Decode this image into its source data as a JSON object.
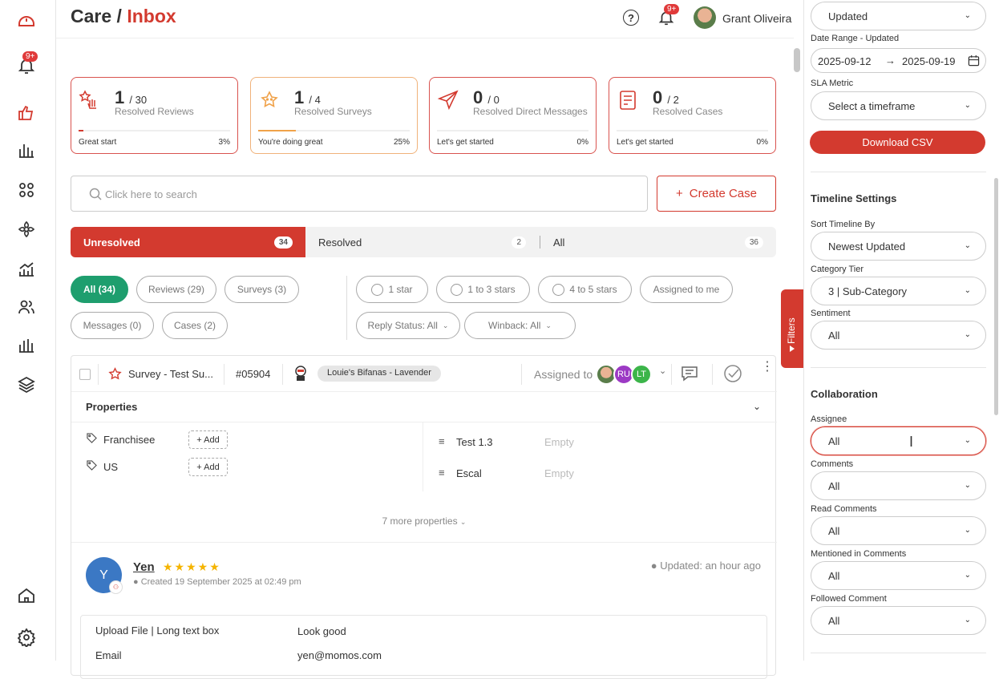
{
  "header": {
    "title_prefix": "Care /",
    "title_accent": "Inbox",
    "help_icon": "?",
    "bell_badge": "9+",
    "user_name": "Grant Oliveira"
  },
  "sidebar": {
    "bell_badge": "9+"
  },
  "kpis": [
    {
      "num": "1",
      "total": "/ 30",
      "label": "Resolved Reviews",
      "footer": "Great start",
      "pct": "3%",
      "progress": 0.03
    },
    {
      "num": "1",
      "total": "/ 4",
      "label": "Resolved Surveys",
      "footer": "You're doing great",
      "pct": "25%",
      "progress": 0.25
    },
    {
      "num": "0",
      "total": "/ 0",
      "label": "Resolved Direct Messages",
      "footer": "Let's get started",
      "pct": "0%",
      "progress": 0
    },
    {
      "num": "0",
      "total": "/ 2",
      "label": "Resolved Cases",
      "footer": "Let's get started",
      "pct": "0%",
      "progress": 0
    }
  ],
  "search": {
    "placeholder": "Click here to search"
  },
  "create_case": {
    "icon": "+",
    "label": "Create Case"
  },
  "tabs": [
    {
      "label": "Unresolved",
      "count": "34"
    },
    {
      "label": "Resolved",
      "count": "2"
    },
    {
      "label": "All",
      "count": "36"
    }
  ],
  "type_chips": [
    "All (34)",
    "Reviews (29)",
    "Surveys (3)",
    "Messages (0)",
    "Cases (2)"
  ],
  "rating_chips": [
    "1 star",
    "1 to 3 stars",
    "4 to 5 stars",
    "Assigned to me"
  ],
  "dropdown_chips": [
    "Reply Status: All",
    "Winback: All"
  ],
  "card": {
    "title": "Survey - Test Su...",
    "id": "#05904",
    "location": "Louie's Bifanas - Lavender",
    "assigned_label": "Assigned to",
    "assignees": [
      "",
      "RU",
      "LT"
    ],
    "properties_title": "Properties",
    "left_props": [
      "Franchisee",
      "US"
    ],
    "add_label": "+ Add",
    "right_props": [
      {
        "name": "Test 1.3",
        "value": "Empty"
      },
      {
        "name": "Escal",
        "value": "Empty"
      }
    ],
    "more": "7 more properties",
    "reviewer_initial": "Y",
    "reviewer_name": "Yen",
    "stars": "★★★★★",
    "created": "Created 19 September 2025 at 02:49 pm",
    "updated": "Updated: an hour ago",
    "answers": [
      {
        "q": "Upload File | Long text box",
        "a": "Look good"
      },
      {
        "q": "Email",
        "a": "yen@momos.com"
      }
    ]
  },
  "filters_tab": "Filters",
  "panel": {
    "top_select": "Updated",
    "date_range_label": "Date Range - Updated",
    "date_from": "2025-09-12",
    "date_arrow": "→",
    "date_to": "2025-09-19",
    "sla_label": "SLA Metric",
    "sla_value": "Select a timeframe",
    "download": "Download CSV",
    "timeline_title": "Timeline Settings",
    "sort_label": "Sort Timeline By",
    "sort_value": "Newest Updated",
    "tier_label": "Category Tier",
    "tier_value": "3 | Sub-Category",
    "sentiment_label": "Sentiment",
    "sentiment_value": "All",
    "collab_title": "Collaboration",
    "assignee_label": "Assignee",
    "assignee_value": "All",
    "comments_label": "Comments",
    "comments_value": "All",
    "read_label": "Read Comments",
    "read_value": "All",
    "mentioned_label": "Mentioned in Comments",
    "mentioned_value": "All",
    "followed_label": "Followed Comment",
    "followed_value": "All"
  },
  "colors": {
    "accent": "#d33a2f",
    "green": "#1e9e6e",
    "orange": "#f0a24a",
    "avatar_blue": "#3b78c4"
  }
}
